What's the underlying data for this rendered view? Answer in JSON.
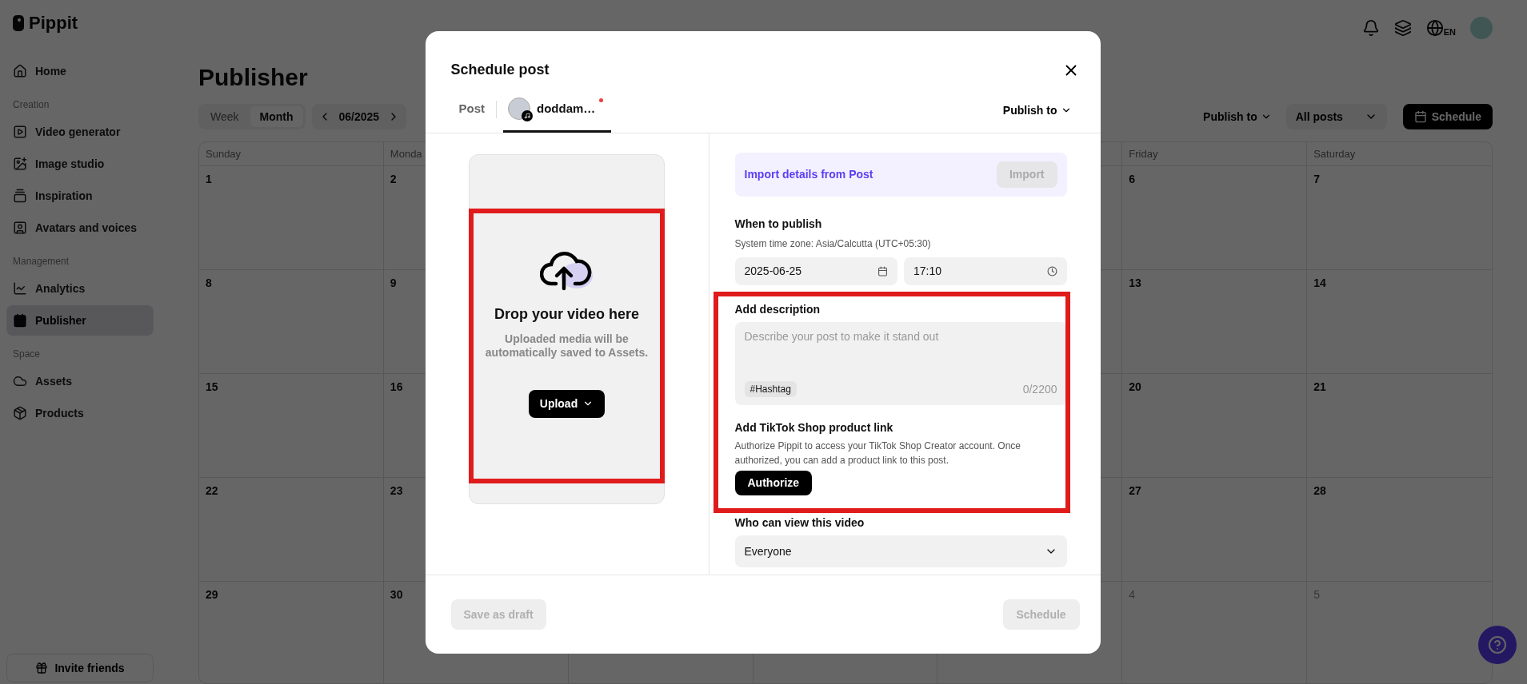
{
  "app": {
    "logo": "Pippit",
    "language": "EN"
  },
  "sidebar": {
    "sections": [
      {
        "items": [
          {
            "label": "Home",
            "selected": false
          }
        ]
      },
      {
        "heading": "Creation",
        "items": [
          {
            "label": "Video generator",
            "selected": false
          },
          {
            "label": "Image studio",
            "selected": false
          },
          {
            "label": "Inspiration",
            "selected": false
          },
          {
            "label": "Avatars and voices",
            "selected": false
          }
        ]
      },
      {
        "heading": "Management",
        "items": [
          {
            "label": "Analytics",
            "selected": false
          },
          {
            "label": "Publisher",
            "selected": true
          }
        ]
      },
      {
        "heading": "Space",
        "items": [
          {
            "label": "Assets",
            "selected": false
          },
          {
            "label": "Products",
            "selected": false
          }
        ]
      }
    ],
    "invite": "Invite friends"
  },
  "page": {
    "title": "Publisher",
    "view_tabs": [
      {
        "label": "Week",
        "selected": false
      },
      {
        "label": "Month",
        "selected": true
      }
    ],
    "period": "06/2025",
    "publish_to": "Publish to",
    "filter": "All posts",
    "schedule_button": "Schedule"
  },
  "calendar": {
    "weekdays_left": [
      "Sunday",
      "Monda"
    ],
    "weekdays_right": [
      "Friday",
      "Saturday"
    ],
    "weeks": [
      {
        "left": [
          {
            "day": "1",
            "muted": false
          },
          {
            "day": "2",
            "muted": false
          }
        ],
        "right": [
          {
            "day": "6",
            "muted": false
          },
          {
            "day": "7",
            "muted": false
          }
        ]
      },
      {
        "left": [
          {
            "day": "8",
            "muted": false
          },
          {
            "day": "9",
            "muted": false
          }
        ],
        "right": [
          {
            "day": "13",
            "muted": false
          },
          {
            "day": "14",
            "muted": false
          }
        ]
      },
      {
        "left": [
          {
            "day": "15",
            "muted": false
          },
          {
            "day": "16",
            "muted": false
          }
        ],
        "right": [
          {
            "day": "20",
            "muted": false
          },
          {
            "day": "21",
            "muted": false
          }
        ]
      },
      {
        "left": [
          {
            "day": "22",
            "muted": false
          },
          {
            "day": "23",
            "muted": false
          }
        ],
        "right": [
          {
            "day": "27",
            "muted": false
          },
          {
            "day": "28",
            "muted": false
          }
        ]
      },
      {
        "left": [
          {
            "day": "29",
            "muted": false
          },
          {
            "day": "30",
            "muted": false
          }
        ],
        "right": [
          {
            "day": "4",
            "muted": true
          },
          {
            "day": "5",
            "muted": true
          }
        ]
      }
    ]
  },
  "modal": {
    "title": "Schedule post",
    "tabs": [
      {
        "kind": "text",
        "label": "Post",
        "selected": false
      },
      {
        "kind": "account",
        "label": "doddam…",
        "selected": true,
        "notification": true
      }
    ],
    "publish_to": "Publish to",
    "upload": {
      "title": "Drop your video here",
      "subtitle": "Uploaded media will be automatically saved to Assets.",
      "button": "Upload",
      "highlighted": true
    },
    "import": {
      "text": "Import details from Post",
      "button": "Import",
      "disabled": true
    },
    "when": {
      "label": "When to publish",
      "timezone": "System time zone: Asia/Calcutta (UTC+05:30)",
      "date": "2025-06-25",
      "time": "17:10"
    },
    "details": {
      "highlighted": true,
      "description": {
        "label": "Add description",
        "placeholder": "Describe your post to make it stand out",
        "hashtag": "#Hashtag",
        "counter": "0/2200"
      },
      "shop": {
        "label": "Add TikTok Shop product link",
        "text": "Authorize Pippit to access your TikTok Shop Creator account. Once authorized, you can add a product link to this post.",
        "button": "Authorize"
      }
    },
    "visibility": {
      "label": "Who can view this video",
      "value": "Everyone"
    },
    "footer": {
      "draft": {
        "label": "Save as draft",
        "disabled": true
      },
      "schedule": {
        "label": "Schedule",
        "disabled": true
      }
    }
  }
}
